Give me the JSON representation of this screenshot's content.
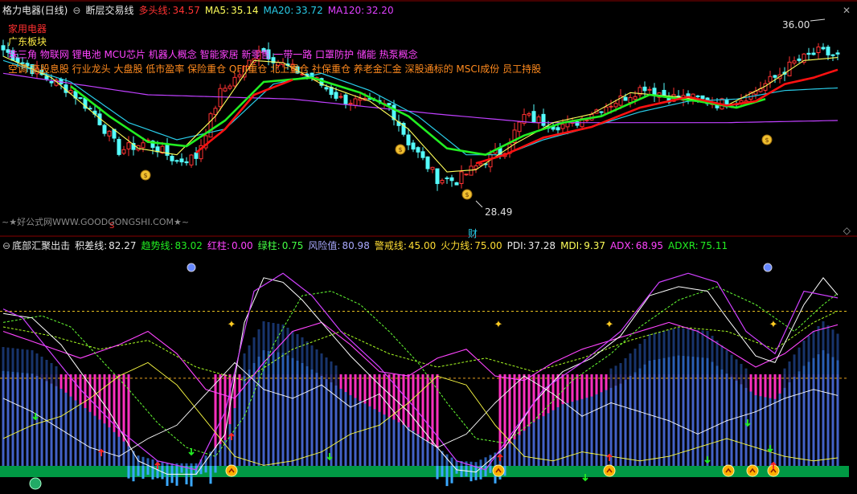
{
  "colors": {
    "bg": "#000000",
    "up": "#ff3232",
    "down": "#54fcfc",
    "ma5": "#ffff5a",
    "ma20": "#29cce8",
    "ma120": "#c040ff",
    "green_line": "#22ee22",
    "red_line": "#ff1111",
    "grid": "#880000",
    "pink_bar": "#ff30c0",
    "blue_bar": "#2f68c8",
    "cyan_bar": "#3aa8ff",
    "green_band": "#009944"
  },
  "header": {
    "title": "格力电器(日线)",
    "indicator": "断层交易线",
    "duotou_label": "多头线:",
    "duotou_value": "34.57",
    "ma5_label": "MA5:",
    "ma5_value": "35.14",
    "ma20_label": "MA20:",
    "ma20_value": "33.72",
    "ma120_label": "MA120:",
    "ma120_value": "32.20"
  },
  "concepts": {
    "line1": "家用电器",
    "line2": "广东板块",
    "line3": "珠三角 物联网 锂电池 MCU芯片 机器人概念 智能家居 新零售 一带一路 口罩防护 储能 热泵概念",
    "line4": "空调 高股息股 行业龙头 大盘股 低市盈率 保险重仓 QFII重仓 北上重仓 社保重仓 养老金汇金 深股通标的 MSCI成份 员工持股"
  },
  "price_labels": {
    "high": "36.00",
    "low": "28.49",
    "fin_marker": "财",
    "s_marker": "S"
  },
  "watermark": "~★好公式网WWW.GOODGONGSHI.COM★~",
  "lower": {
    "name": "底部汇聚出击",
    "jicha_label": "积差线:",
    "jicha_value": "82.27",
    "qushi_label": "趋势线:",
    "qushi_value": "83.02",
    "hongzhu_label": "红柱:",
    "hongzhu_value": "0.00",
    "lvzhu_label": "绿柱:",
    "lvzhu_value": "0.75",
    "fengxian_label": "风险值:",
    "fengxian_value": "80.98",
    "jingjie_label": "警戒线:",
    "jingjie_value": "45.00",
    "huoli_label": "火力线:",
    "huoli_value": "75.00",
    "pdi_label": "PDI:",
    "pdi_value": "37.28",
    "mdi_label": "MDI:",
    "mdi_value": "9.37",
    "adx_label": "ADX:",
    "adx_value": "68.95",
    "adxr_label": "ADXR:",
    "adxr_value": "75.11"
  },
  "chart_data": [
    {
      "type": "candlestick",
      "y_range": [
        28.0,
        37.0
      ],
      "anchor_points": [
        [
          0,
          35.5
        ],
        [
          8,
          34.3
        ],
        [
          14,
          33.6
        ],
        [
          19,
          32.5
        ],
        [
          24,
          30.8
        ],
        [
          30,
          31.2
        ],
        [
          36,
          30.3
        ],
        [
          40,
          30.5
        ],
        [
          45,
          33.5
        ],
        [
          50,
          34.6
        ],
        [
          53,
          35.6
        ],
        [
          58,
          34.8
        ],
        [
          64,
          34.2
        ],
        [
          70,
          33.2
        ],
        [
          75,
          33.0
        ],
        [
          80,
          32.9
        ],
        [
          84,
          31.2
        ],
        [
          90,
          29.5
        ],
        [
          94,
          29.4
        ],
        [
          99,
          30.2
        ],
        [
          104,
          30.9
        ],
        [
          108,
          32.4
        ],
        [
          114,
          32.0
        ],
        [
          118,
          32.0
        ],
        [
          122,
          32.6
        ],
        [
          128,
          33.2
        ],
        [
          133,
          33.8
        ],
        [
          138,
          33.3
        ],
        [
          144,
          33.2
        ],
        [
          148,
          33.0
        ],
        [
          152,
          33.1
        ],
        [
          156,
          33.6
        ],
        [
          160,
          34.2
        ],
        [
          164,
          34.9
        ],
        [
          169,
          35.4
        ],
        [
          173,
          35.2
        ]
      ],
      "ma5": [
        [
          0,
          35.2
        ],
        [
          10,
          34.2
        ],
        [
          20,
          32.3
        ],
        [
          28,
          30.9
        ],
        [
          36,
          30.6
        ],
        [
          44,
          32.4
        ],
        [
          52,
          35.0
        ],
        [
          58,
          34.9
        ],
        [
          66,
          33.9
        ],
        [
          76,
          33.1
        ],
        [
          84,
          31.8
        ],
        [
          92,
          29.8
        ],
        [
          98,
          29.9
        ],
        [
          106,
          31.1
        ],
        [
          114,
          32.1
        ],
        [
          122,
          32.5
        ],
        [
          130,
          33.5
        ],
        [
          140,
          33.3
        ],
        [
          150,
          32.9
        ],
        [
          158,
          33.8
        ],
        [
          166,
          35.0
        ],
        [
          173,
          35.14
        ]
      ],
      "ma20": [
        [
          0,
          35.0
        ],
        [
          14,
          34.0
        ],
        [
          26,
          32.1
        ],
        [
          36,
          31.3
        ],
        [
          46,
          31.8
        ],
        [
          56,
          33.9
        ],
        [
          66,
          34.4
        ],
        [
          76,
          33.6
        ],
        [
          86,
          32.4
        ],
        [
          96,
          30.6
        ],
        [
          104,
          30.6
        ],
        [
          112,
          31.3
        ],
        [
          122,
          31.9
        ],
        [
          132,
          32.6
        ],
        [
          142,
          33.1
        ],
        [
          152,
          33.2
        ],
        [
          162,
          33.6
        ],
        [
          173,
          33.72
        ]
      ],
      "ma120": [
        [
          0,
          34.4
        ],
        [
          30,
          33.4
        ],
        [
          60,
          33.2
        ],
        [
          90,
          32.5
        ],
        [
          110,
          32.1
        ],
        [
          130,
          32.1
        ],
        [
          150,
          32.1
        ],
        [
          173,
          32.2
        ]
      ],
      "green_line": [
        [
          14,
          33.8
        ],
        [
          22,
          32.4
        ],
        [
          30,
          31.2
        ],
        [
          38,
          31.0
        ],
        [
          46,
          32.2
        ],
        [
          54,
          34.0
        ],
        [
          64,
          34.2
        ],
        [
          74,
          33.5
        ],
        [
          84,
          32.4
        ],
        [
          92,
          30.9
        ],
        [
          100,
          30.6
        ],
        [
          108,
          31.5
        ],
        [
          116,
          32.1
        ],
        [
          124,
          32.4
        ],
        [
          134,
          33.4
        ],
        [
          144,
          33.1
        ],
        [
          152,
          32.8
        ],
        [
          158,
          33.2
        ]
      ],
      "red_line": [
        [
          40,
          30.7
        ],
        [
          46,
          31.8
        ],
        [
          52,
          33.4
        ],
        [
          60,
          34.1
        ],
        [
          98,
          30.2
        ],
        [
          104,
          30.6
        ],
        [
          112,
          31.4
        ],
        [
          122,
          31.9
        ],
        [
          132,
          32.8
        ],
        [
          142,
          33.3
        ],
        [
          150,
          32.9
        ],
        [
          156,
          33.1
        ],
        [
          162,
          33.9
        ],
        [
          168,
          34.2
        ],
        [
          173,
          34.57
        ]
      ]
    },
    {
      "type": "bar",
      "lines": [
        "积差线",
        "趋势线",
        "风险值",
        "警戒线",
        "火力线",
        "PDI",
        "MDI",
        "ADX",
        "ADXR"
      ],
      "y_range": [
        0,
        100
      ],
      "values": {
        "警戒线": 45.0,
        "火力线": 75.0,
        "积差线": [
          [
            0,
            74
          ],
          [
            6,
            72
          ],
          [
            12,
            60
          ],
          [
            18,
            42
          ],
          [
            22,
            30
          ],
          [
            28,
            8
          ],
          [
            34,
            2
          ],
          [
            40,
            2
          ],
          [
            46,
            20
          ],
          [
            50,
            70
          ],
          [
            54,
            90
          ],
          [
            58,
            88
          ],
          [
            62,
            80
          ],
          [
            66,
            70
          ],
          [
            72,
            55
          ],
          [
            78,
            42
          ],
          [
            84,
            30
          ],
          [
            90,
            14
          ],
          [
            94,
            4
          ],
          [
            98,
            3
          ],
          [
            104,
            14
          ],
          [
            110,
            34
          ],
          [
            116,
            48
          ],
          [
            122,
            54
          ],
          [
            128,
            64
          ],
          [
            134,
            82
          ],
          [
            140,
            86
          ],
          [
            146,
            84
          ],
          [
            150,
            72
          ],
          [
            156,
            55
          ],
          [
            160,
            52
          ],
          [
            166,
            78
          ],
          [
            170,
            90
          ],
          [
            173,
            82.27
          ]
        ],
        "趋势线": [
          [
            0,
            70
          ],
          [
            8,
            73
          ],
          [
            14,
            68
          ],
          [
            20,
            54
          ],
          [
            26,
            40
          ],
          [
            32,
            25
          ],
          [
            38,
            14
          ],
          [
            44,
            10
          ],
          [
            50,
            28
          ],
          [
            56,
            60
          ],
          [
            62,
            82
          ],
          [
            68,
            84
          ],
          [
            74,
            78
          ],
          [
            80,
            66
          ],
          [
            86,
            52
          ],
          [
            92,
            34
          ],
          [
            98,
            18
          ],
          [
            104,
            16
          ],
          [
            110,
            26
          ],
          [
            118,
            44
          ],
          [
            126,
            56
          ],
          [
            132,
            68
          ],
          [
            140,
            80
          ],
          [
            148,
            86
          ],
          [
            156,
            78
          ],
          [
            164,
            66
          ],
          [
            170,
            78
          ],
          [
            173,
            83.02
          ]
        ],
        "风险值": [
          [
            0,
            76
          ],
          [
            4,
            72
          ],
          [
            10,
            56
          ],
          [
            16,
            40
          ],
          [
            24,
            22
          ],
          [
            32,
            8
          ],
          [
            40,
            4
          ],
          [
            46,
            30
          ],
          [
            52,
            84
          ],
          [
            58,
            92
          ],
          [
            64,
            82
          ],
          [
            70,
            66
          ],
          [
            78,
            50
          ],
          [
            86,
            30
          ],
          [
            94,
            8
          ],
          [
            100,
            4
          ],
          [
            106,
            22
          ],
          [
            112,
            40
          ],
          [
            120,
            52
          ],
          [
            128,
            66
          ],
          [
            136,
            88
          ],
          [
            142,
            92
          ],
          [
            148,
            88
          ],
          [
            154,
            66
          ],
          [
            160,
            56
          ],
          [
            166,
            84
          ],
          [
            173,
            80.98
          ]
        ],
        "PDI": [
          [
            0,
            36
          ],
          [
            6,
            30
          ],
          [
            12,
            22
          ],
          [
            18,
            14
          ],
          [
            24,
            10
          ],
          [
            30,
            18
          ],
          [
            36,
            24
          ],
          [
            42,
            38
          ],
          [
            48,
            52
          ],
          [
            54,
            40
          ],
          [
            60,
            36
          ],
          [
            66,
            42
          ],
          [
            72,
            32
          ],
          [
            78,
            38
          ],
          [
            84,
            22
          ],
          [
            90,
            14
          ],
          [
            96,
            20
          ],
          [
            102,
            34
          ],
          [
            108,
            46
          ],
          [
            114,
            38
          ],
          [
            120,
            28
          ],
          [
            126,
            34
          ],
          [
            132,
            30
          ],
          [
            138,
            26
          ],
          [
            144,
            20
          ],
          [
            150,
            26
          ],
          [
            156,
            30
          ],
          [
            162,
            36
          ],
          [
            168,
            40
          ],
          [
            173,
            37.28
          ]
        ],
        "MDI": [
          [
            0,
            18
          ],
          [
            6,
            24
          ],
          [
            12,
            28
          ],
          [
            18,
            36
          ],
          [
            24,
            46
          ],
          [
            30,
            52
          ],
          [
            36,
            42
          ],
          [
            42,
            26
          ],
          [
            48,
            10
          ],
          [
            54,
            6
          ],
          [
            60,
            8
          ],
          [
            66,
            12
          ],
          [
            72,
            20
          ],
          [
            78,
            24
          ],
          [
            84,
            34
          ],
          [
            90,
            46
          ],
          [
            96,
            42
          ],
          [
            102,
            24
          ],
          [
            108,
            10
          ],
          [
            114,
            8
          ],
          [
            120,
            12
          ],
          [
            126,
            10
          ],
          [
            132,
            8
          ],
          [
            138,
            10
          ],
          [
            144,
            14
          ],
          [
            150,
            18
          ],
          [
            156,
            14
          ],
          [
            162,
            10
          ],
          [
            168,
            8
          ],
          [
            173,
            9.37
          ]
        ],
        "ADX": [
          [
            0,
            66
          ],
          [
            8,
            60
          ],
          [
            16,
            54
          ],
          [
            24,
            60
          ],
          [
            30,
            66
          ],
          [
            36,
            56
          ],
          [
            42,
            40
          ],
          [
            48,
            36
          ],
          [
            54,
            52
          ],
          [
            60,
            66
          ],
          [
            66,
            70
          ],
          [
            72,
            60
          ],
          [
            78,
            48
          ],
          [
            84,
            46
          ],
          [
            90,
            54
          ],
          [
            96,
            58
          ],
          [
            102,
            46
          ],
          [
            108,
            44
          ],
          [
            114,
            52
          ],
          [
            120,
            58
          ],
          [
            126,
            62
          ],
          [
            132,
            66
          ],
          [
            138,
            70
          ],
          [
            144,
            66
          ],
          [
            150,
            58
          ],
          [
            156,
            50
          ],
          [
            162,
            56
          ],
          [
            168,
            66
          ],
          [
            173,
            68.95
          ]
        ],
        "ADXR": [
          [
            0,
            68
          ],
          [
            10,
            64
          ],
          [
            20,
            58
          ],
          [
            30,
            62
          ],
          [
            40,
            50
          ],
          [
            50,
            44
          ],
          [
            60,
            58
          ],
          [
            70,
            66
          ],
          [
            80,
            56
          ],
          [
            90,
            50
          ],
          [
            100,
            54
          ],
          [
            110,
            48
          ],
          [
            120,
            54
          ],
          [
            130,
            62
          ],
          [
            140,
            68
          ],
          [
            150,
            66
          ],
          [
            160,
            58
          ],
          [
            168,
            70
          ],
          [
            173,
            75.11
          ]
        ]
      },
      "红柱": 0.0,
      "绿柱": 0.75
    }
  ]
}
